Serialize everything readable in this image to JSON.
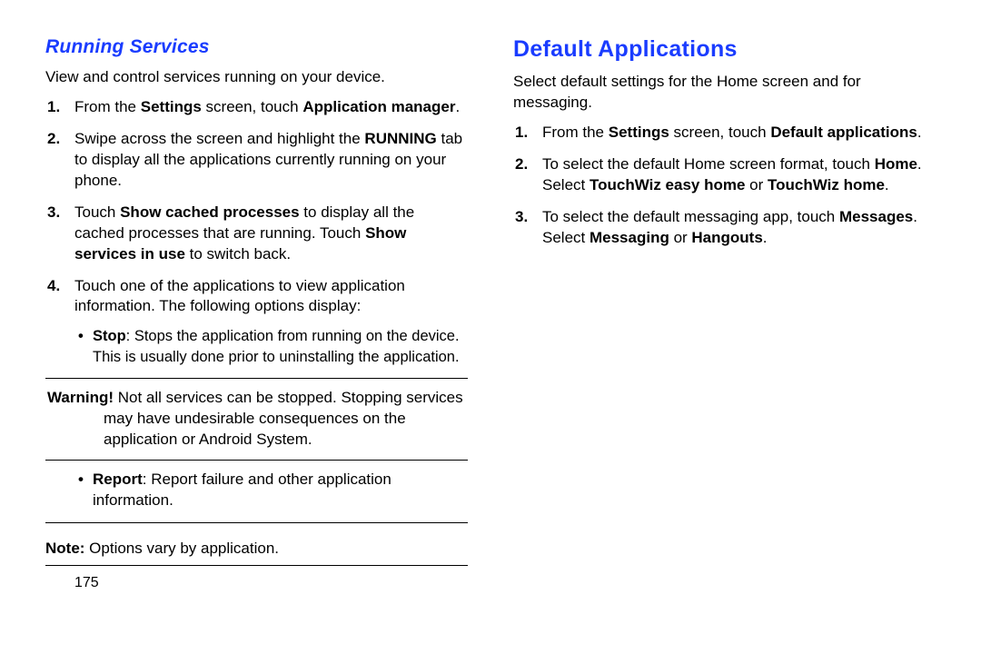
{
  "left": {
    "heading": "Running Services",
    "intro": "View and control services running on your device.",
    "step1_a": "From the ",
    "step1_b": "Settings",
    "step1_c": " screen, touch ",
    "step1_d": "Application manager",
    "step1_e": ".",
    "step2_a": "Swipe across the screen and highlight the ",
    "step2_b": "RUNNING",
    "step2_c": " tab to display all the applications currently running on your phone.",
    "step3_a": "Touch ",
    "step3_b": "Show cached processes",
    "step3_c": " to display all the cached processes that are running. Touch ",
    "step3_d": "Show services in use",
    "step3_e": " to switch back.",
    "step4": "Touch one of the applications to view application information. The following options display:",
    "bullet_stop_a": "Stop",
    "bullet_stop_b": ": Stops the application from running on the device. This is usually done prior to uninstalling the application.",
    "warn_label": "Warning!",
    "warn_text": " Not all services can be stopped. Stopping services may have undesirable consequences on the application or Android System.",
    "bullet_report_a": "Report",
    "bullet_report_b": ": Report failure and other application information.",
    "note_label": "Note:",
    "note_text": " Options vary by application.",
    "page": "175"
  },
  "right": {
    "heading": "Default Applications",
    "intro": "Select default settings for the Home screen and for messaging.",
    "step1_a": "From the ",
    "step1_b": "Settings",
    "step1_c": " screen, touch ",
    "step1_d": "Default applications",
    "step1_e": ".",
    "step2_a": "To select the default Home screen format, touch ",
    "step2_b": "Home",
    "step2_c": ". Select ",
    "step2_d": "TouchWiz easy home",
    "step2_e": " or ",
    "step2_f": "TouchWiz home",
    "step2_g": ".",
    "step3_a": "To select the default messaging app, touch ",
    "step3_b": "Messages",
    "step3_c": ". Select ",
    "step3_d": "Messaging",
    "step3_e": " or ",
    "step3_f": "Hangouts",
    "step3_g": "."
  }
}
